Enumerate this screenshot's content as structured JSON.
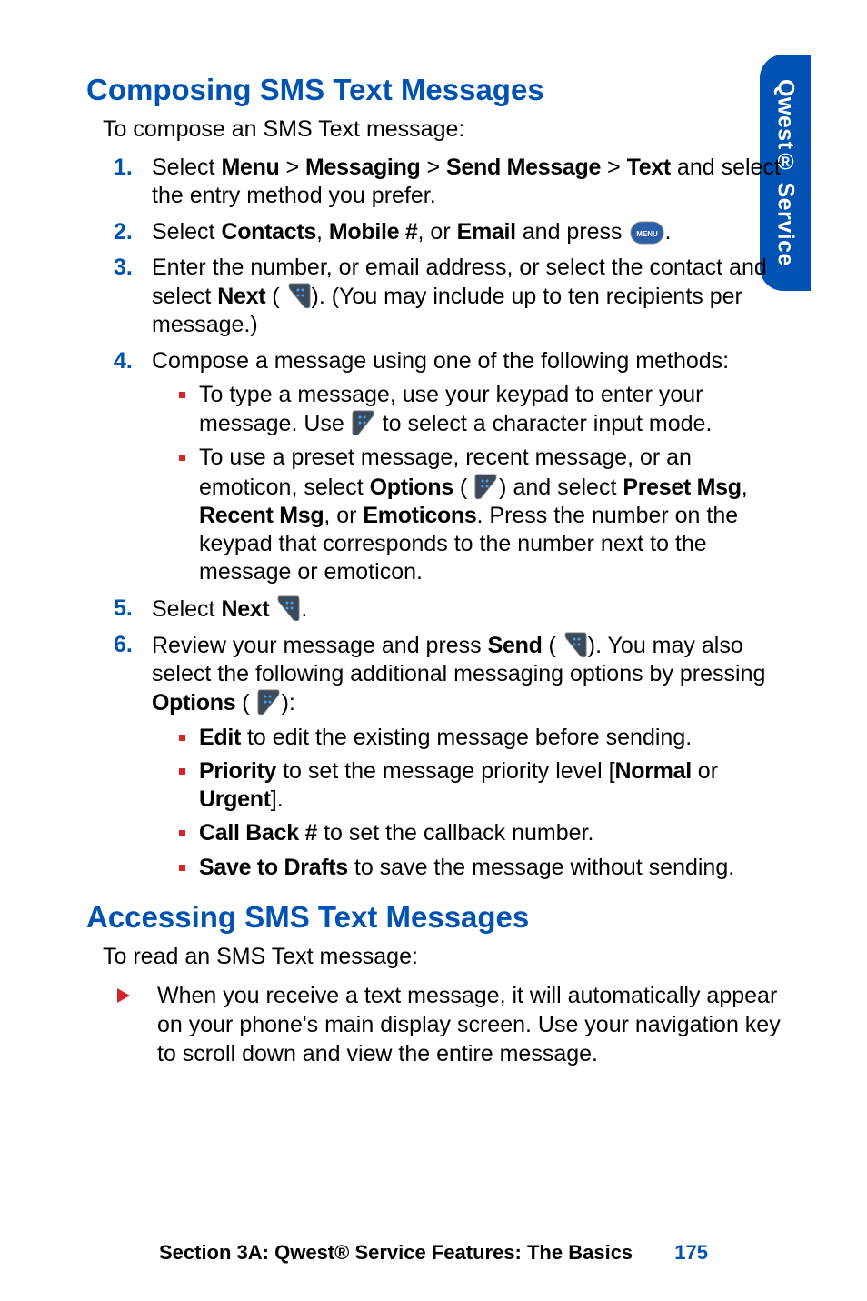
{
  "sidebar": {
    "label": "Qwest® Service"
  },
  "section1": {
    "title": "Composing SMS Text Messages",
    "intro": "To compose an SMS Text message:",
    "steps": {
      "s1a": "Select ",
      "s1_menu": "Menu",
      "s1_gt1": " > ",
      "s1_messaging": "Messaging",
      "s1_gt2": " > ",
      "s1_sendmsg": "Send Message",
      "s1_gt3": " > ",
      "s1_text": "Text",
      "s1b": " and select the entry method you prefer.",
      "s2a": "Select ",
      "s2_contacts": "Contacts",
      "s2_c1": ", ",
      "s2_mobile": "Mobile #",
      "s2_c2": ", or ",
      "s2_email": "Email",
      "s2b": " and press ",
      "s2c": ".",
      "s3a": "Enter the number, or email address, or select the contact and select ",
      "s3_next": "Next",
      "s3b": " (",
      "s3c": "). (You may include up to ten recipients per message.)",
      "s4a": "Compose a message using one of the following methods:",
      "s4_i1a": "To type a message, use your keypad to enter your message. Use ",
      "s4_i1b": " to select a character input mode.",
      "s4_i2a": "To use a preset message, recent message, or an emoticon, select ",
      "s4_i2_options": "Options",
      "s4_i2b": " (",
      "s4_i2c": ") and select ",
      "s4_i2_preset": "Preset Msg",
      "s4_i2d": ", ",
      "s4_i2_recent": "Recent Msg",
      "s4_i2e": ", or ",
      "s4_i2_emoticons": "Emoticons",
      "s4_i2f": ". Press the number on the keypad that corresponds to the number next to the message or emoticon.",
      "s5a": "Select ",
      "s5_next": "Next",
      "s5b": " ",
      "s5c": ".",
      "s6a": "Review your message and press ",
      "s6_send": "Send",
      "s6b": " (",
      "s6c": "). You may also select the following additional messaging options by pressing ",
      "s6_options": "Options",
      "s6d": " (",
      "s6e": "):",
      "s6_i1a": "Edit",
      "s6_i1b": " to edit the existing message before sending.",
      "s6_i2a": "Priority",
      "s6_i2b": " to set the message priority level [",
      "s6_i2c": "Normal",
      "s6_i2d": " or ",
      "s6_i2e": "Urgent",
      "s6_i2f": "].",
      "s6_i3a": "Call Back #",
      "s6_i3b": " to set the callback number.",
      "s6_i4a": "Save to Drafts",
      "s6_i4b": " to save the message without sending."
    }
  },
  "section2": {
    "title": "Accessing SMS Text Messages",
    "intro": "To read an SMS Text message:",
    "item": "When you receive a text message, it will automatically appear on your phone's main display screen. Use your navigation key to scroll down and view the entire message."
  },
  "footer": {
    "text": "Section 3A: Qwest® Service Features: The Basics",
    "page": "175"
  }
}
